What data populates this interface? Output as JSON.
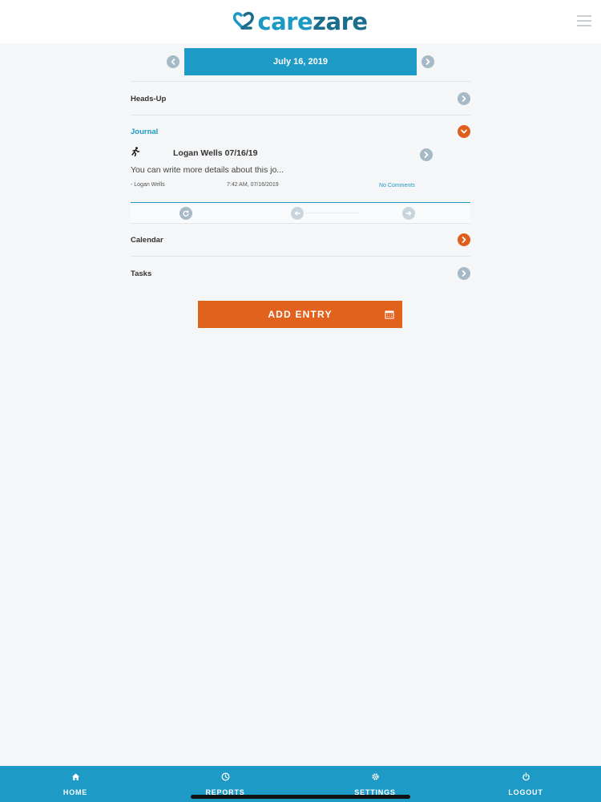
{
  "header": {
    "logo_part1": "care",
    "logo_part2": "zare",
    "menu_icon": "hamburger-menu-icon"
  },
  "date_nav": {
    "date": "July 16, 2019",
    "prev_icon": "chevron-left-icon",
    "next_icon": "chevron-right-icon"
  },
  "sections": {
    "heads_up": "Heads-Up",
    "journal": "Journal",
    "calendar": "Calendar",
    "tasks": "Tasks"
  },
  "journal_entry": {
    "icon": "running-person-icon",
    "title": "Logan Wells 07/16/19",
    "body": "You can write more details about this jo...",
    "author": "- Logan Wells",
    "timestamp": "7:42 AM, 07/16/2019",
    "comments": "No Comments"
  },
  "add_entry": {
    "label": "ADD ENTRY",
    "icon": "calendar-icon"
  },
  "tabbar": {
    "home": "HOME",
    "reports": "REPORTS",
    "settings": "SETTINGS",
    "logout": "LOGOUT"
  },
  "colors": {
    "primary": "#1e9ac6",
    "accent": "#e0621c",
    "logo": "#1b6d8c",
    "chevron_grey": "#a6b9c6"
  }
}
